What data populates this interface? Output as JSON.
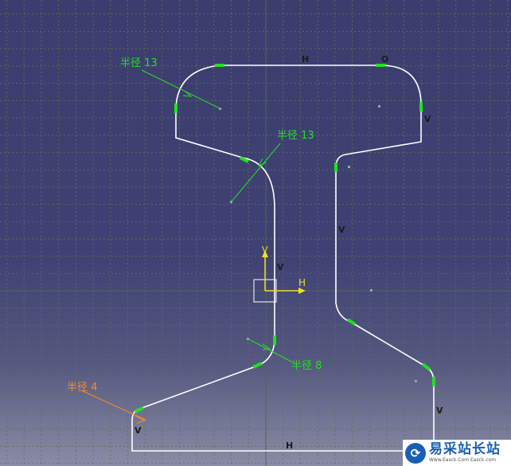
{
  "dimensions": {
    "r1": "半径 13",
    "r2": "半径 13",
    "r3": "半径 8",
    "r4": "半径 4"
  },
  "constraints": {
    "h_top": "H",
    "o_top": "O",
    "v_right_top": "V",
    "v_web_right": "V",
    "v_web_left": "V",
    "v_right_bottom": "V",
    "v_left_bottom": "V",
    "h_bottom": "H"
  },
  "axis": {
    "v": "V",
    "h": "H"
  },
  "watermark": {
    "logo": "⟳",
    "title": "易采站长站",
    "url": "Www.Easck.Com  Easck.com"
  },
  "colors": {
    "background_top": "#3c3d6e",
    "background_bottom": "#8a8ca6",
    "grid": "#5f6c55",
    "profile": "#ffffff",
    "dimension": "#22e022",
    "dimension_active": "#ff8a1e",
    "axis": "#f0e020"
  }
}
